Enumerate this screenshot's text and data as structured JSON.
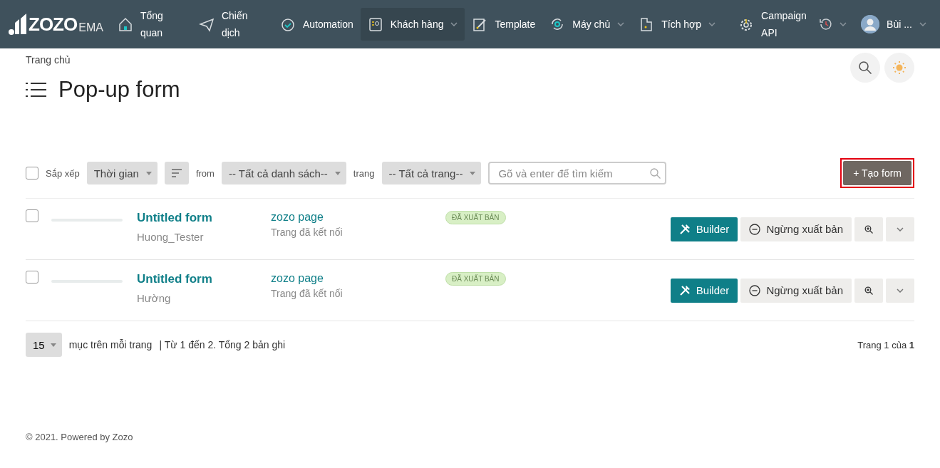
{
  "logo": {
    "brand": "ZOZO",
    "suffix": "EMA"
  },
  "nav": [
    {
      "label": "Tổng quan",
      "dropdown": false,
      "selected": false
    },
    {
      "label": "Chiến dịch",
      "dropdown": false,
      "selected": false
    },
    {
      "label": "Automation",
      "dropdown": false,
      "selected": false
    },
    {
      "label": "Khách hàng",
      "dropdown": true,
      "selected": true
    },
    {
      "label": "Template",
      "dropdown": false,
      "selected": false
    },
    {
      "label": "Máy chủ",
      "dropdown": true,
      "selected": false
    },
    {
      "label": "Tích hợp",
      "dropdown": true,
      "selected": false
    },
    {
      "label": "Campaign API",
      "dropdown": false,
      "selected": false
    }
  ],
  "user": {
    "name": "Bùi ..."
  },
  "breadcrumb": "Trang chủ",
  "page_title": "Pop-up form",
  "toolbar": {
    "select_all_checked": false,
    "sort_label": "Sắp xếp",
    "sort_value": "Thời gian",
    "from_label": "from",
    "list_value": "-- Tất cả danh sách--",
    "page_label": "trang",
    "page_value": "-- Tất cả trang--",
    "search": {
      "placeholder": "Gõ và enter để tìm kiếm"
    },
    "create_button": "+ Tạo form",
    "create_highlighted": true
  },
  "rows": [
    {
      "checked": false,
      "title": "Untitled form",
      "author": "Huong_Tester",
      "page": "zozo page",
      "page_status": "Trang đã kết nối",
      "badge": "ĐÃ XUẤT BẢN",
      "builder": "Builder",
      "unpublish": "Ngừng xuất bản"
    },
    {
      "checked": false,
      "title": "Untitled form",
      "author": "Hường",
      "page": "zozo page",
      "page_status": "Trang đã kết nối",
      "badge": "ĐÃ XUẤT BẢN",
      "builder": "Builder",
      "unpublish": "Ngừng xuất bản"
    }
  ],
  "pagination": {
    "per_page": "15",
    "per_page_label": "mục trên mỗi trang",
    "summary": "| Từ 1 đến 2. Tổng 2 bản ghi",
    "page_info": "Trang 1 của **1**"
  },
  "footer": "© 2021. Powered by Zozo"
}
